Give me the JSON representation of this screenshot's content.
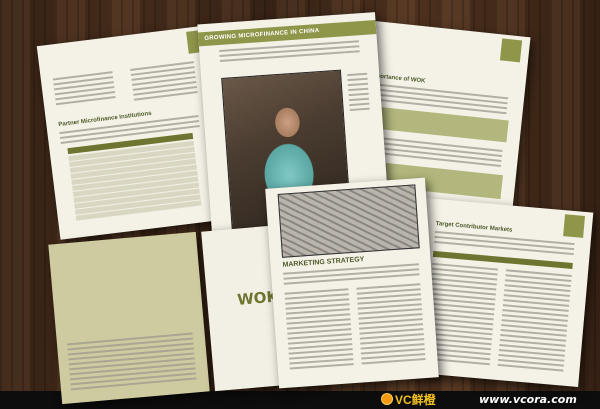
{
  "brochure": {
    "page_b_title": "GROWING MICROFINANCE IN CHINA",
    "page_c_heading": "Importance of WOK",
    "page_e_heading": "MARKETING STRATEGY",
    "page_f_heading": "Target Contributor Markets",
    "logo_text": "WOK",
    "page_a_heading": "Partner Microfinance Institutions"
  },
  "watermark": {
    "brand": "VC鲜橙",
    "url": "www.vcora.com"
  },
  "colors": {
    "olive": "#8f9549",
    "olive_dark": "#6f7530",
    "paper": "#f4f1e6",
    "wood": "#3a2416"
  }
}
